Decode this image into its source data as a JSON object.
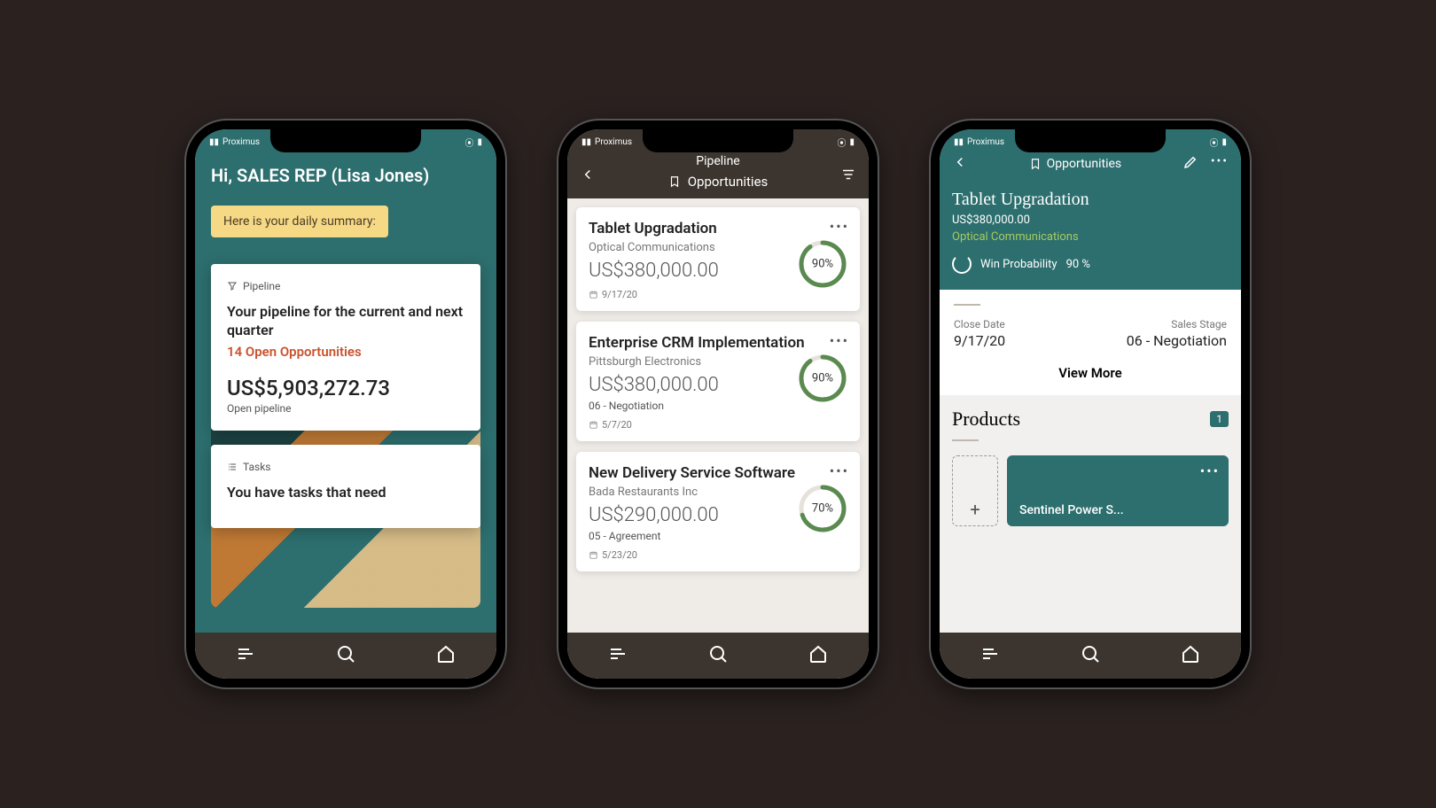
{
  "carrier": "Proximus",
  "phoneA": {
    "greeting": "Hi, SALES REP (Lisa Jones)",
    "summary_pill": "Here is your daily summary:",
    "pipeline_card": {
      "chip": "Pipeline",
      "title": "Your pipeline for the current and next quarter",
      "open_line": "14 Open Opportunities",
      "amount": "US$5,903,272.73",
      "sub": "Open pipeline"
    },
    "tasks_card": {
      "chip": "Tasks",
      "title": "You have tasks that need"
    }
  },
  "phoneB": {
    "header_title1": "Pipeline",
    "header_title2": "Opportunities",
    "opps": [
      {
        "name": "Tablet Upgradation",
        "company": "Optical Communications",
        "amount": "US$380,000.00",
        "stage": "",
        "date": "9/17/20",
        "pct": 90
      },
      {
        "name": "Enterprise CRM Implementation",
        "company": "Pittsburgh Electronics",
        "amount": "US$380,000.00",
        "stage": "06 - Negotiation",
        "date": "5/7/20",
        "pct": 90
      },
      {
        "name": "New Delivery Service Software",
        "company": "Bada Restaurants Inc",
        "amount": "US$290,000.00",
        "stage": "05 - Agreement",
        "date": "5/23/20",
        "pct": 70
      }
    ]
  },
  "phoneC": {
    "header_label": "Opportunities",
    "name": "Tablet Upgradation",
    "amount": "US$380,000.00",
    "company": "Optical Communications",
    "win_label": "Win Probability",
    "win_pct": "90 %",
    "close_date_label": "Close Date",
    "close_date": "9/17/20",
    "sales_stage_label": "Sales Stage",
    "sales_stage": "06 - Negotiation",
    "view_more": "View More",
    "products_label": "Products",
    "products_count": "1",
    "product_name": "Sentinel Power S..."
  }
}
